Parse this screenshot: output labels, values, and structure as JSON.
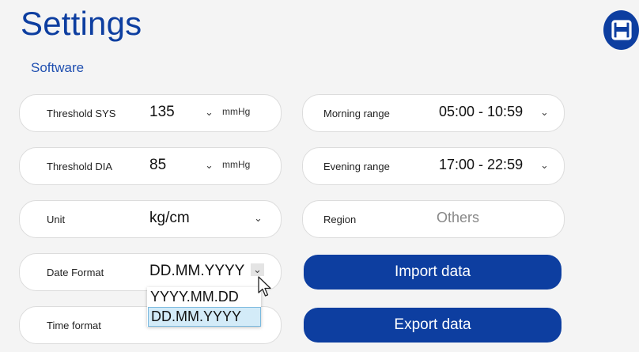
{
  "page": {
    "title": "Settings",
    "subtitle": "Software"
  },
  "left": {
    "threshold_sys": {
      "label": "Threshold SYS",
      "value": "135",
      "unit": "mmHg"
    },
    "threshold_dia": {
      "label": "Threshold DIA",
      "value": "85",
      "unit": "mmHg"
    },
    "unit": {
      "label": "Unit",
      "value": "kg/cm"
    },
    "date_format": {
      "label": "Date Format",
      "value": "DD.MM.YYYY"
    },
    "time_format": {
      "label": "Time format"
    }
  },
  "right": {
    "morning_range": {
      "label": "Morning range",
      "value": "05:00 - 10:59"
    },
    "evening_range": {
      "label": "Evening range",
      "value": "17:00 - 22:59"
    },
    "region": {
      "label": "Region",
      "value": "Others"
    }
  },
  "buttons": {
    "import": "Import data",
    "export": "Export data"
  },
  "date_format_dropdown": {
    "options": [
      "YYYY.MM.DD",
      "DD.MM.YYYY"
    ],
    "selected": "DD.MM.YYYY"
  },
  "icons": {
    "save": "save-icon",
    "chevron": "chevron-down-icon",
    "cursor": "mouse-pointer-icon"
  },
  "colors": {
    "accent": "#0d3ea0",
    "selection": "#d3ebf8"
  }
}
